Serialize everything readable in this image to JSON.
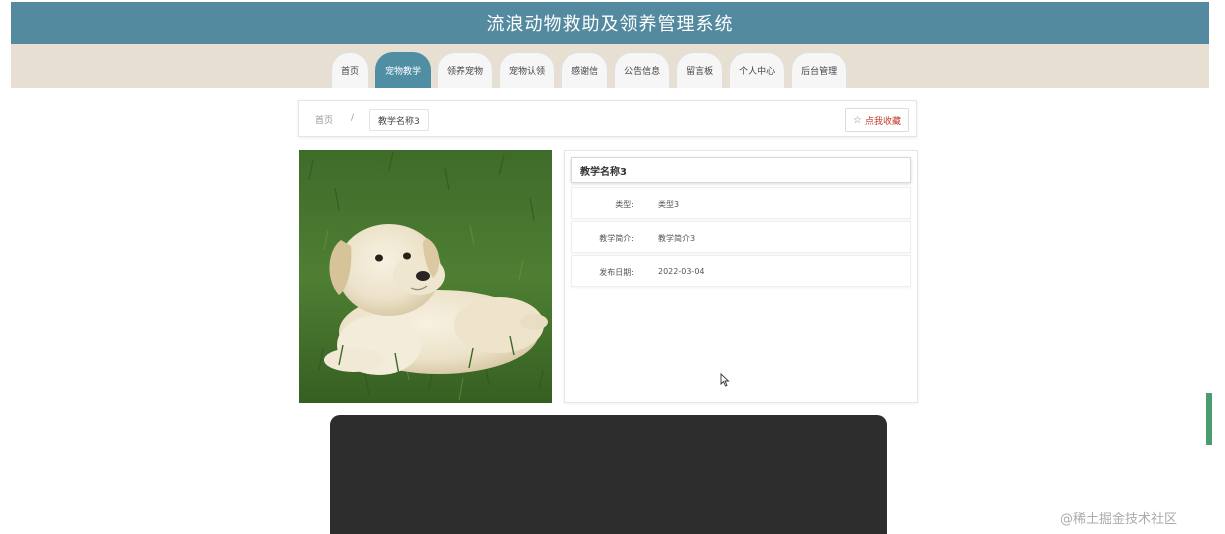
{
  "header": {
    "title": "流浪动物救助及领养管理系统"
  },
  "nav": {
    "tabs": [
      {
        "label": "首页",
        "active": false
      },
      {
        "label": "宠物教学",
        "active": true
      },
      {
        "label": "领养宠物",
        "active": false
      },
      {
        "label": "宠物认领",
        "active": false
      },
      {
        "label": "感谢信",
        "active": false
      },
      {
        "label": "公告信息",
        "active": false
      },
      {
        "label": "留言板",
        "active": false
      },
      {
        "label": "个人中心",
        "active": false
      },
      {
        "label": "后台管理",
        "active": false
      }
    ]
  },
  "breadcrumb": {
    "home": "首页",
    "separator": "/",
    "current": "教学名称3",
    "favorite_label": "点我收藏",
    "favorite_icon": "star-outline-icon"
  },
  "detail": {
    "title": "教学名称3",
    "rows": [
      {
        "label": "类型:",
        "value": "类型3"
      },
      {
        "label": "教学简介:",
        "value": "教学简介3"
      },
      {
        "label": "发布日期:",
        "value": "2022-03-04"
      }
    ]
  },
  "media": {
    "photo_subject": "labrador-puppy-on-grass",
    "video_player": "dark-video-panel"
  },
  "watermark": "@稀土掘金技术社区",
  "colors": {
    "header_bg": "#548a9f",
    "nav_bg": "#e6dfd2",
    "active_tab": "#4f8ea3",
    "video_bg": "#2d2d2d",
    "favorite_text": "#c0392b"
  }
}
